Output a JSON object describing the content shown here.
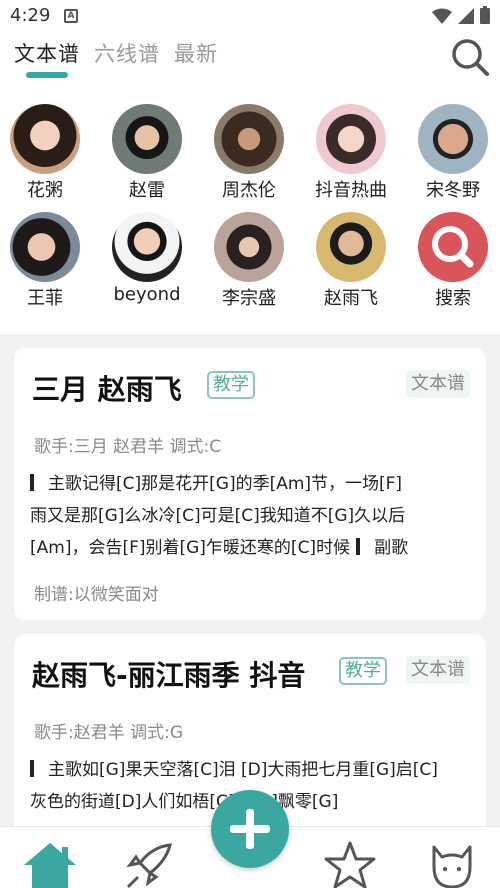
{
  "status": {
    "time": "4:29",
    "notif_glyph": "A"
  },
  "tabs": [
    {
      "label": "文本谱",
      "active": true
    },
    {
      "label": "六线谱",
      "active": false
    },
    {
      "label": "最新",
      "active": false
    }
  ],
  "artists": [
    {
      "name": "花粥"
    },
    {
      "name": "赵雷"
    },
    {
      "name": "周杰伦"
    },
    {
      "name": "抖音热曲"
    },
    {
      "name": "宋冬野"
    },
    {
      "name": "王菲"
    },
    {
      "name": "beyond"
    },
    {
      "name": "李宗盛"
    },
    {
      "name": "赵雨飞"
    },
    {
      "name": "搜索"
    }
  ],
  "cards": [
    {
      "title": "三月 赵雨飞",
      "teach_badge": "教学",
      "type_badge": "文本谱",
      "meta": "歌手:三月 赵君羊  调式:C",
      "lyrics_line1": "主歌记得[C]那是花开[G]的季[Am]节，一场[F]",
      "lyrics_line2": "雨又是那[G]么冰冷[C]可是[C]我知道不[G]久以后",
      "lyrics_line3a": "[Am]，会告[F]别着[G]乍暖还寒的[C]时候",
      "lyrics_line3b": "副歌",
      "author": "制谱:以微笑面对"
    },
    {
      "title": "赵雨飞-丽江雨季 抖音",
      "teach_badge": "教学",
      "type_badge": "文本谱",
      "meta": "歌手:赵君羊  调式:G",
      "lyrics_line1": "主歌如[G]果天空落[C]泪 [D]大雨把七月重[G]启[C]",
      "lyrics_line2": "灰色的街道[D]人们如梧[C]花[G]飘零[G]"
    }
  ],
  "colors": {
    "accent": "#3aa7a0",
    "search_red": "#d9555a"
  },
  "icons": [
    "search-icon",
    "home-icon",
    "rocket-icon",
    "add-icon",
    "star-icon",
    "cat-icon"
  ]
}
